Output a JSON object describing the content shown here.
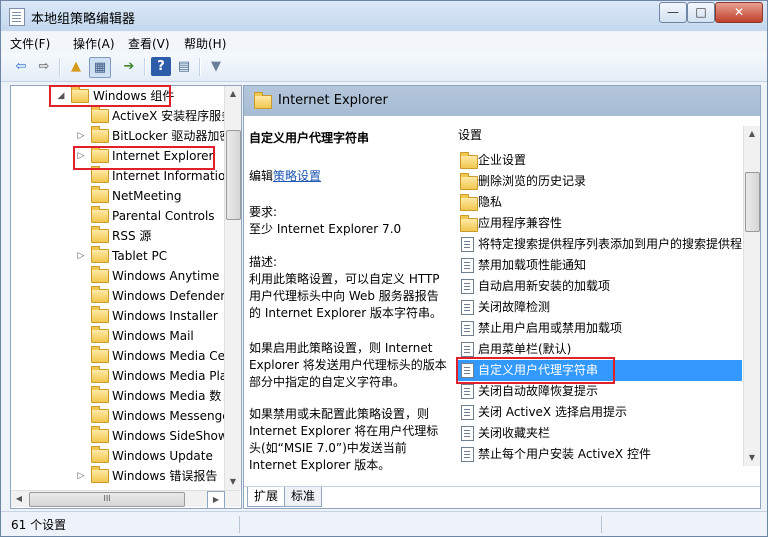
{
  "window": {
    "title": "本地组策略编辑器",
    "buttons": {
      "minimize": "—",
      "maximize": "□",
      "close": "✕"
    }
  },
  "menu": [
    {
      "label": "文件(F)"
    },
    {
      "label": "操作(A)"
    },
    {
      "label": "查看(V)"
    },
    {
      "label": "帮助(H)"
    }
  ],
  "toolbar": {
    "icons": [
      "back-arrow-icon",
      "forward-arrow-icon",
      "up-folder-icon",
      "show-hide-tree-icon",
      "export-list-icon",
      "help-icon",
      "properties-icon",
      "filter-icon"
    ],
    "glyphs": {
      "back": "⇦",
      "forward": "⇨",
      "up": "▲",
      "tree": "▦",
      "export": "➔",
      "help": "?",
      "props": "▤",
      "filter": "▼"
    }
  },
  "tree": {
    "items": [
      {
        "label": "Windows 组件",
        "arrow": "◢",
        "level": 0
      },
      {
        "label": "ActiveX 安装程序服务",
        "arrow": "",
        "level": 1
      },
      {
        "label": "BitLocker 驱动器加密",
        "arrow": "▷",
        "level": 1
      },
      {
        "label": "Internet Explorer",
        "arrow": "▷",
        "level": 1
      },
      {
        "label": "Internet Information",
        "arrow": "",
        "level": 1
      },
      {
        "label": "NetMeeting",
        "arrow": "",
        "level": 1
      },
      {
        "label": "Parental Controls",
        "arrow": "",
        "level": 1
      },
      {
        "label": "RSS 源",
        "arrow": "",
        "level": 1
      },
      {
        "label": "Tablet PC",
        "arrow": "▷",
        "level": 1
      },
      {
        "label": "Windows Anytime Up",
        "arrow": "",
        "level": 1
      },
      {
        "label": "Windows Defender",
        "arrow": "",
        "level": 1
      },
      {
        "label": "Windows Installer",
        "arrow": "",
        "level": 1
      },
      {
        "label": "Windows Mail",
        "arrow": "",
        "level": 1
      },
      {
        "label": "Windows Media Cen",
        "arrow": "",
        "level": 1
      },
      {
        "label": "Windows Media Pla",
        "arrow": "",
        "level": 1
      },
      {
        "label": "Windows Media 数",
        "arrow": "",
        "level": 1
      },
      {
        "label": "Windows Messenge",
        "arrow": "",
        "level": 1
      },
      {
        "label": "Windows SideShow",
        "arrow": "",
        "level": 1
      },
      {
        "label": "Windows Update",
        "arrow": "",
        "level": 1
      },
      {
        "label": "Windows 错误报告",
        "arrow": "▷",
        "level": 1
      }
    ],
    "scroll": {
      "up": "▲",
      "down": "▼",
      "left": "◀",
      "right": "▶",
      "grip": "III"
    }
  },
  "detail": {
    "header_title": "Internet Explorer",
    "policy_title": "自定义用户代理字符串",
    "edit_prefix": "编辑",
    "edit_link": "策略设置",
    "req_label": "要求:",
    "req_value": "至少 Internet Explorer 7.0",
    "desc_label": "描述:",
    "desc_text": "利用此策略设置，可以自定义 HTTP 用户代理标头中向 Web 服务器报告的 Internet Explorer 版本字符串。",
    "enabled_text": "如果启用此策略设置，则 Internet Explorer 将发送用户代理标头的版本部分中指定的自定义字符串。",
    "disabled_text": "如果禁用或未配置此策略设置，则 Internet Explorer 将在用户代理标头(如“MSIE 7.0”)中发送当前 Internet Explorer 版本。"
  },
  "settings": {
    "header": "设置",
    "items": [
      {
        "label": "企业设置",
        "type": "folder"
      },
      {
        "label": "删除浏览的历史记录",
        "type": "folder"
      },
      {
        "label": "隐私",
        "type": "folder"
      },
      {
        "label": "应用程序兼容性",
        "type": "folder"
      },
      {
        "label": "将特定搜索提供程序列表添加到用户的搜索提供程序",
        "type": "policy"
      },
      {
        "label": "禁用加载项性能通知",
        "type": "policy"
      },
      {
        "label": "自动启用新安装的加载项",
        "type": "policy"
      },
      {
        "label": "关闭故障检测",
        "type": "policy"
      },
      {
        "label": "禁止用户启用或禁用加载项",
        "type": "policy"
      },
      {
        "label": "启用菜单栏(默认)",
        "type": "policy"
      },
      {
        "label": "自定义用户代理字符串",
        "type": "policy",
        "selected": true
      },
      {
        "label": "关闭自动故障恢复提示",
        "type": "policy"
      },
      {
        "label": "关闭 ActiveX 选择启用提示",
        "type": "policy"
      },
      {
        "label": "关闭收藏夹栏",
        "type": "policy"
      },
      {
        "label": "禁止每个用户安装 ActiveX 控件",
        "type": "policy"
      }
    ]
  },
  "tabs": [
    {
      "label": "扩展",
      "active": true
    },
    {
      "label": "标准",
      "active": false
    }
  ],
  "status": {
    "text": "61 个设置"
  },
  "colors": {
    "highlight": "#e0202a",
    "selection": "#3399ff",
    "link": "#1e57b4"
  }
}
